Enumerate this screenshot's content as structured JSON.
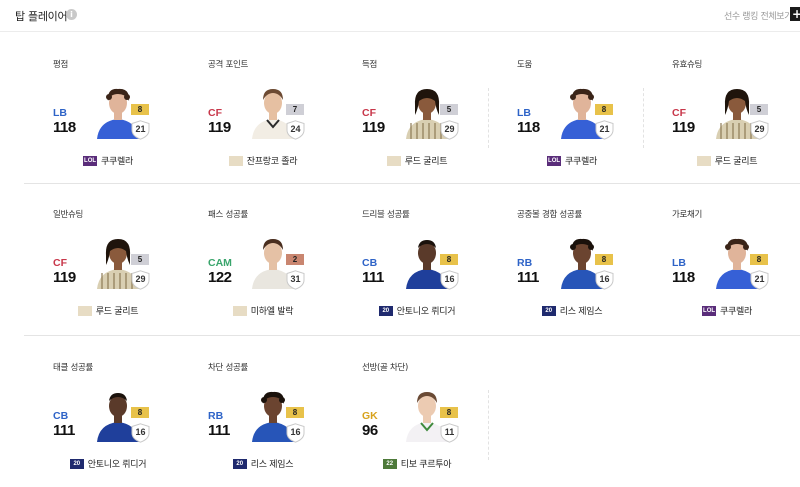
{
  "header": {
    "title": "탑 플레이어",
    "info_icon": "i",
    "view_all": "선수 랭킹 전체보기",
    "plus_icon": "+"
  },
  "colors": {
    "LB": "#2e63c7",
    "RB": "#2e63c7",
    "CB": "#2e63c7",
    "CF": "#c8374a",
    "CAM": "#3aa56c",
    "GK": "#d8a21c"
  },
  "cards": [
    {
      "title": "평점",
      "pos": "LB",
      "ovr": "118",
      "grade": "8",
      "grade_color": "#e8c24a",
      "level": "21",
      "season": "LOL",
      "season_bg": "#5a2d7a",
      "season_fg": "#ffffff",
      "name": "쿠쿠렐라",
      "photo": "cucurella"
    },
    {
      "title": "공격 포인트",
      "pos": "CF",
      "ovr": "119",
      "grade": "7",
      "grade_color": "#cfcfd6",
      "level": "24",
      "season": "",
      "season_bg": "#e7dcc4",
      "season_fg": "#8a7a5a",
      "name": "잔프랑코 졸라",
      "photo": "zola"
    },
    {
      "title": "득점",
      "pos": "CF",
      "ovr": "119",
      "grade": "5",
      "grade_color": "#cfcfd6",
      "level": "29",
      "season": "",
      "season_bg": "#e7dcc4",
      "season_fg": "#8a7a5a",
      "name": "루드 굴리트",
      "photo": "gullit"
    },
    {
      "title": "도움",
      "pos": "LB",
      "ovr": "118",
      "grade": "8",
      "grade_color": "#e8c24a",
      "level": "21",
      "season": "LOL",
      "season_bg": "#5a2d7a",
      "season_fg": "#ffffff",
      "name": "쿠쿠렐라",
      "photo": "cucurella"
    },
    {
      "title": "유효슈팅",
      "pos": "CF",
      "ovr": "119",
      "grade": "5",
      "grade_color": "#cfcfd6",
      "level": "29",
      "season": "",
      "season_bg": "#e7dcc4",
      "season_fg": "#8a7a5a",
      "name": "루드 굴리트",
      "photo": "gullit"
    },
    {
      "title": "일반슈팅",
      "pos": "CF",
      "ovr": "119",
      "grade": "5",
      "grade_color": "#cfcfd6",
      "level": "29",
      "season": "",
      "season_bg": "#e7dcc4",
      "season_fg": "#8a7a5a",
      "name": "루드 굴리트",
      "photo": "gullit"
    },
    {
      "title": "패스 성공률",
      "pos": "CAM",
      "ovr": "122",
      "grade": "2",
      "grade_color": "#c98670",
      "level": "31",
      "season": "",
      "season_bg": "#e7dcc4",
      "season_fg": "#8a7a5a",
      "name": "미하엘 발락",
      "photo": "ballack"
    },
    {
      "title": "드리블 성공률",
      "pos": "CB",
      "ovr": "111",
      "grade": "8",
      "grade_color": "#e8c24a",
      "level": "16",
      "season": "20",
      "season_bg": "#1f2a6e",
      "season_fg": "#ffffff",
      "name": "안토니오 뤼디거",
      "photo": "rudiger"
    },
    {
      "title": "공중볼 경합 성공률",
      "pos": "RB",
      "ovr": "111",
      "grade": "8",
      "grade_color": "#e8c24a",
      "level": "16",
      "season": "20",
      "season_bg": "#1f2a6e",
      "season_fg": "#ffffff",
      "name": "리스 제임스",
      "photo": "james"
    },
    {
      "title": "가로채기",
      "pos": "LB",
      "ovr": "118",
      "grade": "8",
      "grade_color": "#e8c24a",
      "level": "21",
      "season": "LOL",
      "season_bg": "#5a2d7a",
      "season_fg": "#ffffff",
      "name": "쿠쿠렐라",
      "photo": "cucurella"
    },
    {
      "title": "태클 성공률",
      "pos": "CB",
      "ovr": "111",
      "grade": "8",
      "grade_color": "#e8c24a",
      "level": "16",
      "season": "20",
      "season_bg": "#1f2a6e",
      "season_fg": "#ffffff",
      "name": "안토니오 뤼디거",
      "photo": "rudiger"
    },
    {
      "title": "차단 성공률",
      "pos": "RB",
      "ovr": "111",
      "grade": "8",
      "grade_color": "#e8c24a",
      "level": "16",
      "season": "20",
      "season_bg": "#1f2a6e",
      "season_fg": "#ffffff",
      "name": "리스 제임스",
      "photo": "james"
    },
    {
      "title": "선방(골 차단)",
      "pos": "GK",
      "ovr": "96",
      "grade": "8",
      "grade_color": "#e8c24a",
      "level": "11",
      "season": "22",
      "season_bg": "#4e7a3a",
      "season_fg": "#ffffff",
      "name": "티보 쿠르투아",
      "photo": "courtois"
    }
  ]
}
